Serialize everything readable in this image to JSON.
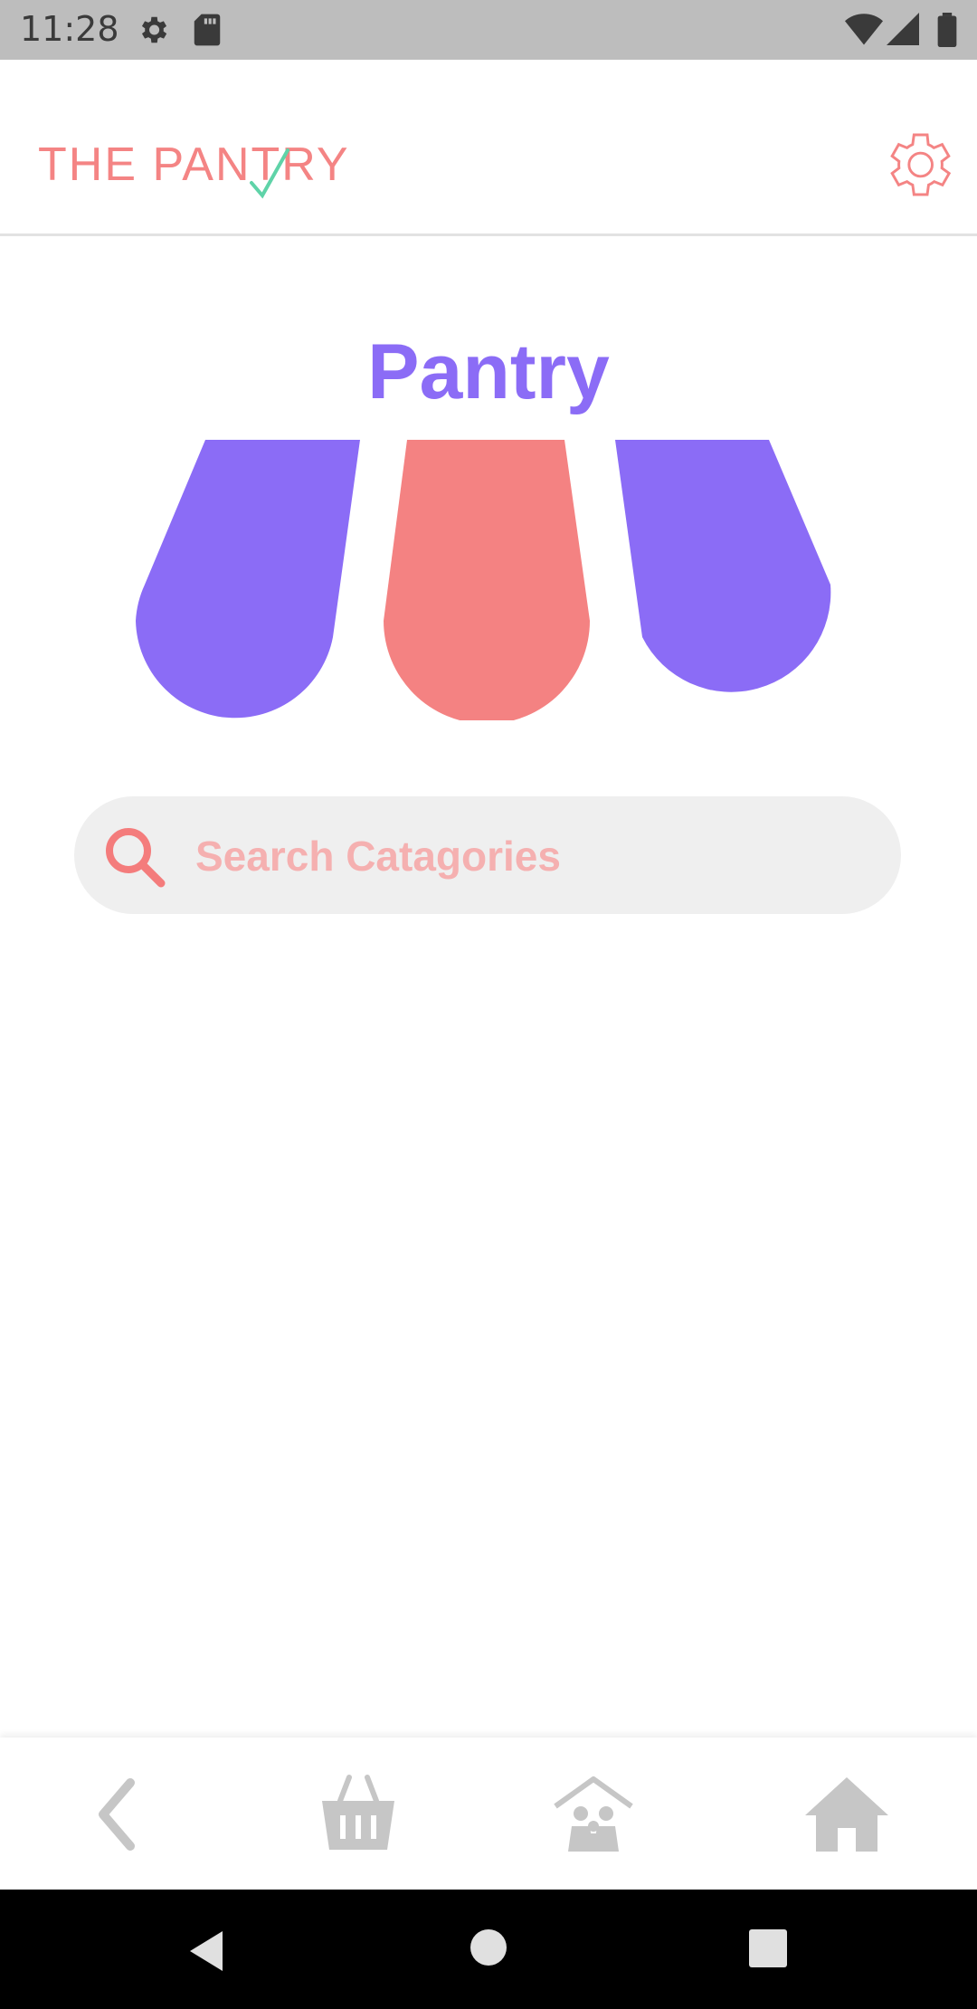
{
  "status_bar": {
    "time": "11:28",
    "icons": [
      "settings-icon",
      "sd-card-icon",
      "wifi-icon",
      "signal-icon",
      "battery-icon"
    ]
  },
  "app_bar": {
    "logo_text": "THE PANTRY",
    "settings_icon": "gear-icon"
  },
  "main": {
    "title": "Pantry",
    "awning_colors": [
      "#8b6cf6",
      "#f48282",
      "#8b6cf6"
    ]
  },
  "search": {
    "placeholder": "Search Catagories",
    "value": ""
  },
  "bottom_nav": {
    "items": [
      "back-icon",
      "basket-icon",
      "family-home-icon",
      "home-icon"
    ]
  },
  "colors": {
    "accent_purple": "#8b6cf6",
    "accent_pink": "#f48484",
    "check_green": "#5fd3a8",
    "nav_gray": "#c6c6c6"
  }
}
